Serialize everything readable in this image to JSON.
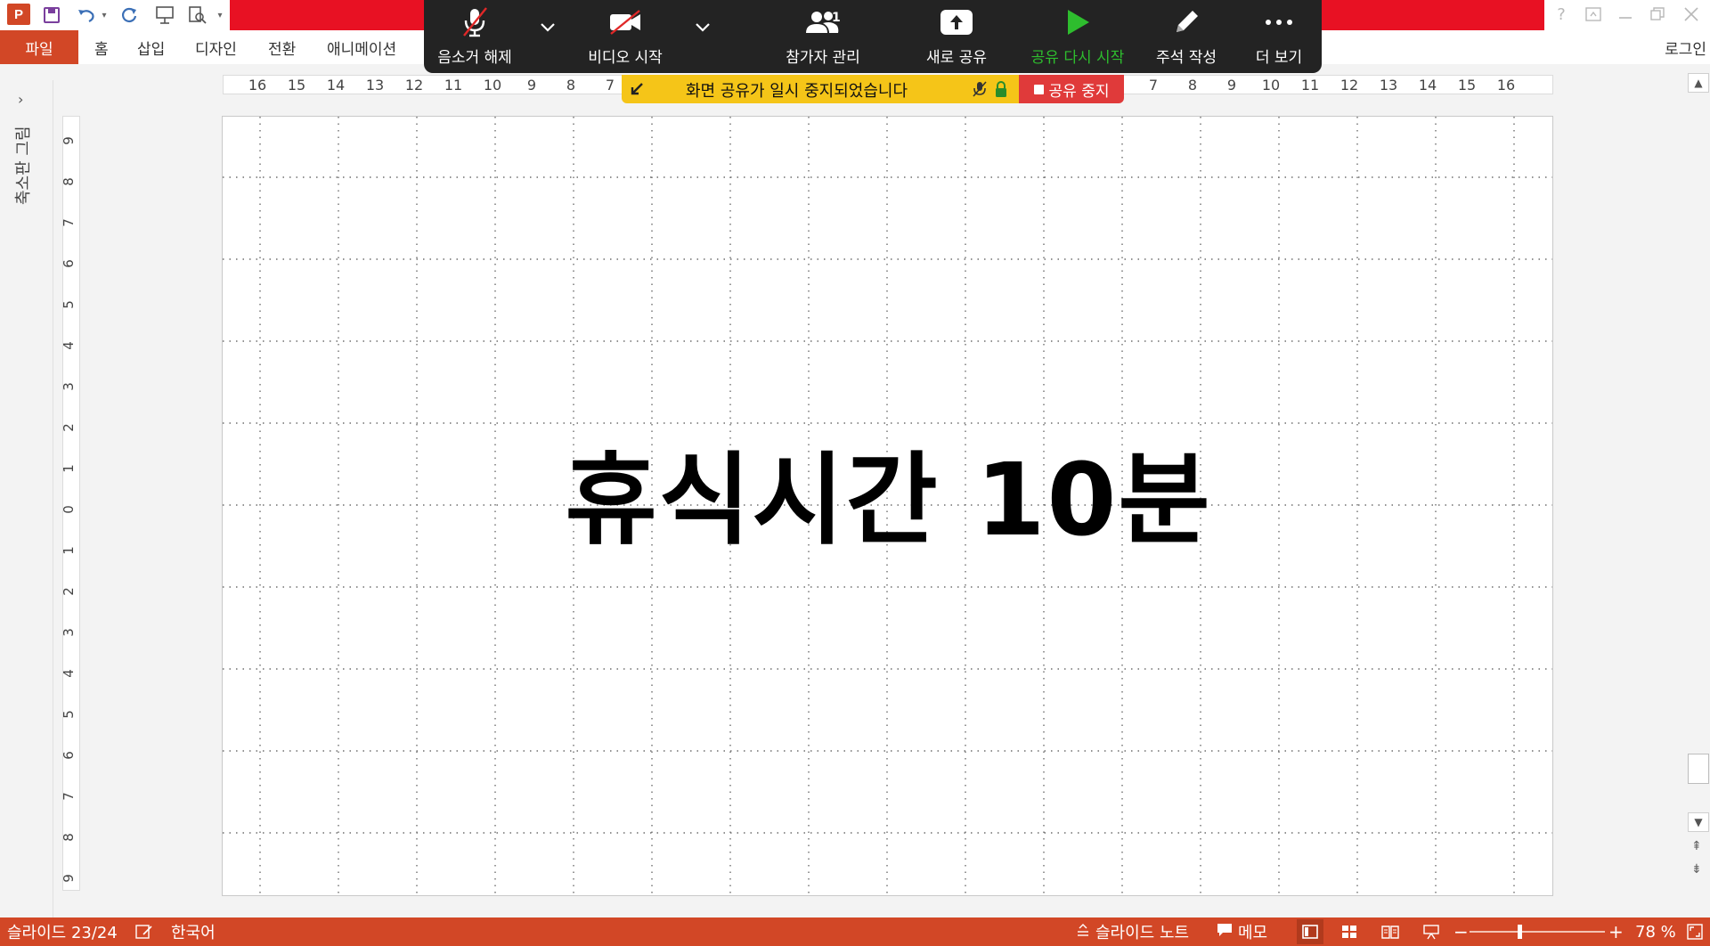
{
  "window": {
    "app_logo": "P",
    "help_glyph": "?",
    "login_label": "로그인"
  },
  "ribbon": {
    "file_tab": "파일",
    "tabs": [
      "홈",
      "삽입",
      "디자인",
      "전환",
      "애니메이션"
    ]
  },
  "thumbnail_pane": {
    "label": "축소판 그림",
    "expand_glyph": "›"
  },
  "rulers": {
    "horizontal": [
      "16",
      "15",
      "14",
      "13",
      "12",
      "11",
      "10",
      "9",
      "8",
      "7",
      "7",
      "8",
      "9",
      "10",
      "11",
      "12",
      "13",
      "14",
      "15",
      "16"
    ],
    "vertical": [
      "9",
      "8",
      "7",
      "6",
      "5",
      "4",
      "3",
      "2",
      "1",
      "0",
      "1",
      "2",
      "3",
      "4",
      "5",
      "6",
      "7",
      "8",
      "9"
    ]
  },
  "slide": {
    "title": "휴식시간 10분"
  },
  "zoom_toolbar": {
    "unmute_label": "음소거 해제",
    "start_video_label": "비디오 시작",
    "participants_label": "참가자 관리",
    "participants_count": "1",
    "new_share_label": "새로 공유",
    "resume_share_label": "공유 다시 시작",
    "annotate_label": "주석 작성",
    "more_label": "더 보기",
    "resume_color": "#2ebd2e"
  },
  "share_banner": {
    "paused_text": "화면 공유가 일시 중지되었습니다",
    "stop_share_label": "공유 중지"
  },
  "statusbar": {
    "slide_indicator": "슬라이드 23/24",
    "language": "한국어",
    "notes_label": "슬라이드 노트",
    "comments_label": "메모",
    "zoom_level": "78 %",
    "zoom_minus": "−",
    "zoom_plus": "+",
    "zoom_fraction": 0.37
  },
  "colors": {
    "accent": "#d24726",
    "banner_red": "#e81123",
    "pause_yellow": "#f5c518",
    "stop_red": "#e03a3a",
    "zoom_dark": "#232323"
  }
}
